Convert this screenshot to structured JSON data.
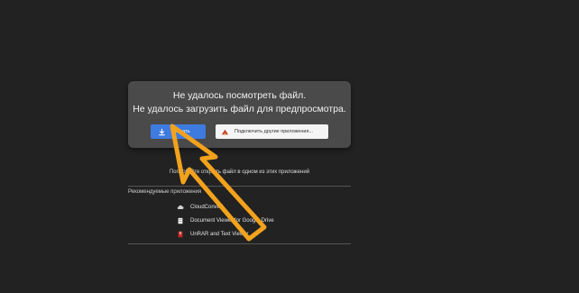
{
  "dialog": {
    "error_line1": "Не удалось посмотреть файл.",
    "error_line2": "Не удалось загрузить файл для предпросмотра.",
    "download_label": "Скачать",
    "connect_apps_label": "Подключить другие приложения..."
  },
  "suggestions": {
    "prompt": "Попробуйте открыть файл в одном из этих приложений",
    "section_label": "Рекомендуемые приложения",
    "apps": [
      {
        "name": "CloudConvert",
        "icon": "cloud-icon"
      },
      {
        "name": "Document Viewer for Google Drive",
        "icon": "document-icon"
      },
      {
        "name": "UnRAR and Text Viewer",
        "icon": "archive-icon"
      }
    ]
  },
  "colors": {
    "background": "#222222",
    "dialog": "#4a4a4a",
    "accent": "#3d7be0",
    "annotation_arrow": "#f3a21d"
  }
}
